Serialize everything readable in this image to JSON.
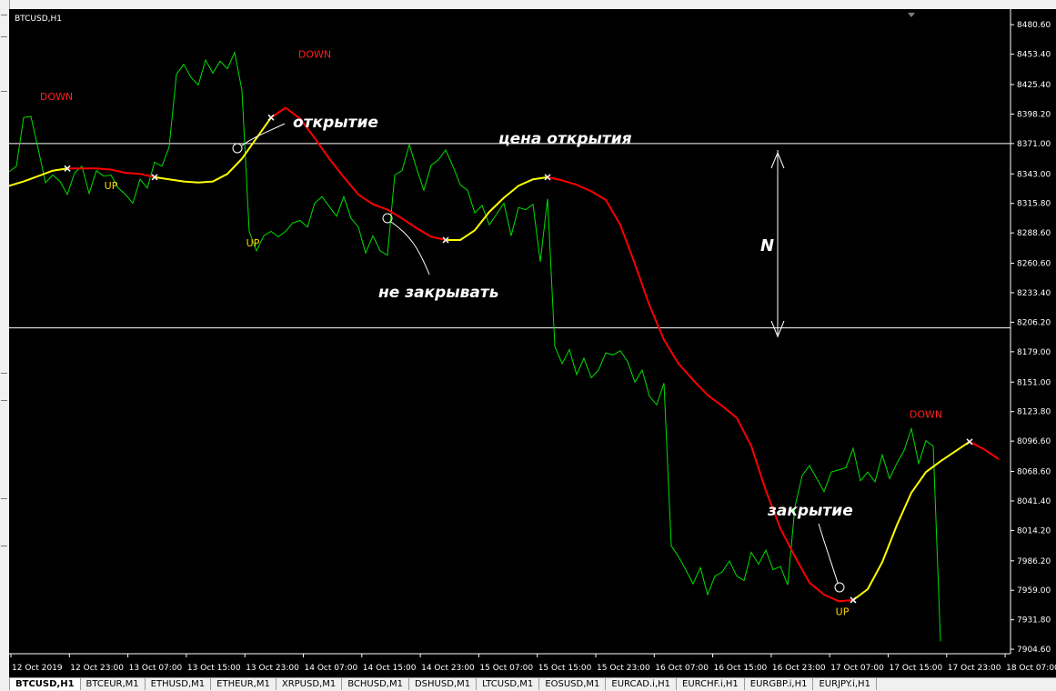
{
  "symbol_label": "BTCUSD,H1",
  "tabs": [
    "BTCUSD,H1",
    "BTCEUR,M1",
    "ETHUSD,M1",
    "ETHEUR,M1",
    "XRPUSD,M1",
    "BCHUSD,M1",
    "DSHUSD,M1",
    "LTCUSD,M1",
    "EOSUSD,M1",
    "EURCAD.i,H1",
    "EURCHF.i,H1",
    "EURGBP.i,H1",
    "EURJPY.i,H1"
  ],
  "active_tab": 0,
  "colors": {
    "background": "#000000",
    "price": "#00e000",
    "ma_up": "#ffff00",
    "ma_down": "#ff0000",
    "text": "#ffffff",
    "signal_text": "#ff2020",
    "up_text": "#ffd700",
    "hline": "#ffffff"
  },
  "annotations": {
    "open_label": "открытие",
    "open_price_label": "цена открытия",
    "dont_close_label": "не закрывать",
    "close_label": "закрытие",
    "n_label": "N"
  },
  "chart_data": {
    "type": "line",
    "title": "BTCUSD,H1",
    "x": [
      "12 Oct 2019",
      "12 Oct 23:00",
      "13 Oct 07:00",
      "13 Oct 15:00",
      "13 Oct 23:00",
      "14 Oct 07:00",
      "14 Oct 15:00",
      "14 Oct 23:00",
      "15 Oct 07:00",
      "15 Oct 15:00",
      "15 Oct 23:00",
      "16 Oct 07:00",
      "16 Oct 15:00",
      "16 Oct 23:00",
      "17 Oct 07:00",
      "17 Oct 15:00",
      "17 Oct 23:00",
      "18 Oct 07:00"
    ],
    "yticks": [
      8480.6,
      8453.4,
      8425.4,
      8398.2,
      8371.0,
      8343.0,
      8315.8,
      8288.6,
      8260.6,
      8233.4,
      8206.2,
      8179.0,
      8151.0,
      8123.8,
      8096.6,
      8068.6,
      8041.4,
      8014.2,
      7986.2,
      7959.0,
      7931.8,
      7904.6
    ],
    "ylim": [
      7900.5,
      8495.0
    ],
    "grid": false,
    "series": [
      {
        "values": [
          8345,
          8350,
          8395,
          8396,
          8366,
          8335,
          8342,
          8336,
          8324,
          8344,
          8350,
          8325,
          8346,
          8341,
          8342,
          8330,
          8324,
          8316,
          8338,
          8330,
          8354,
          8350,
          8368,
          8435,
          8444,
          8432,
          8425,
          8448,
          8436,
          8447,
          8440,
          8455,
          8420,
          8290,
          8272,
          8286,
          8290,
          8285,
          8290,
          8298,
          8300,
          8294,
          8316,
          8322,
          8313,
          8304,
          8322,
          8302,
          8294,
          8270,
          8286,
          8272,
          8268,
          8342,
          8346,
          8370,
          8348,
          8328,
          8351,
          8356,
          8365,
          8350,
          8333,
          8328,
          8307,
          8314,
          8296,
          8306,
          8316,
          8286,
          8312,
          8310,
          8315,
          8262,
          8320,
          8184,
          8168,
          8181,
          8158,
          8173,
          8155,
          8162,
          8178,
          8176,
          8180,
          8170,
          8151,
          8162,
          8138,
          8130,
          8150,
          8000,
          7990,
          7978,
          7965,
          7980,
          7955,
          7972,
          7976,
          7986,
          7972,
          7968,
          7994,
          7983,
          7996,
          7978,
          7981,
          7964,
          8036,
          8065,
          8074,
          8062,
          8050,
          8068,
          8070,
          8072,
          8090,
          8060,
          8068,
          8059,
          8084,
          8062,
          8076,
          8088,
          8108,
          8076,
          8097,
          8092,
          7912
        ]
      },
      {
        "values": [
          8332,
          8336,
          8341,
          8346,
          8348,
          8348,
          8348,
          8347,
          8344,
          8343,
          8340,
          8338,
          8336,
          8335,
          8336,
          8343,
          8357,
          8376,
          8395,
          8404,
          8394,
          8376,
          8357,
          8340,
          8324,
          8315,
          8310,
          8302,
          8293,
          8285,
          8282,
          8282,
          8291,
          8308,
          8321,
          8332,
          8338,
          8340,
          8337,
          8333,
          8327,
          8319,
          8296,
          8260,
          8222,
          8190,
          8168,
          8153,
          8139,
          8129,
          8118,
          8092,
          8051,
          8016,
          7990,
          7966,
          7955,
          7949,
          7950,
          7960,
          7985,
          8019,
          8049,
          8068,
          8078,
          8087,
          8096,
          8089,
          8080
        ]
      }
    ],
    "ma_up_segments": [
      [
        0,
        4
      ],
      [
        10,
        18
      ],
      [
        30,
        37
      ],
      [
        58,
        66
      ]
    ],
    "signal_markers": [
      {
        "label": "DOWN",
        "x": 6.5,
        "y": 8411,
        "kind": "down"
      },
      {
        "label": "DOWN",
        "x": 42,
        "y": 8450,
        "kind": "down"
      },
      {
        "label": "UP",
        "x": 14,
        "y": 8329,
        "kind": "up"
      },
      {
        "label": "UP",
        "x": 33.5,
        "y": 8276,
        "kind": "up"
      },
      {
        "label": "UP",
        "x": 114.5,
        "y": 7936,
        "kind": "up"
      },
      {
        "label": "DOWN",
        "x": 126,
        "y": 8118,
        "kind": "down"
      }
    ],
    "hlines": [
      8371.0,
      8201.0
    ]
  }
}
